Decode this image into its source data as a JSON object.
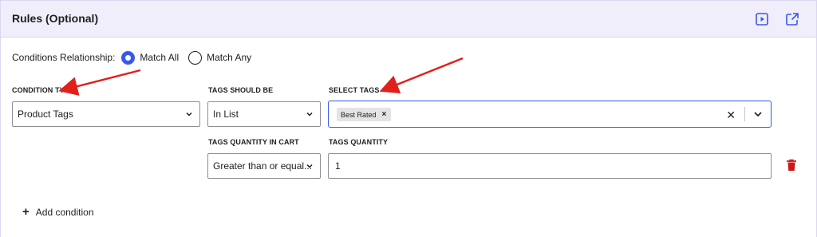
{
  "header": {
    "title": "Rules (Optional)",
    "icons": [
      "play-video-icon",
      "external-link-icon"
    ]
  },
  "relationship": {
    "label": "Conditions Relationship:",
    "options": [
      {
        "label": "Match All",
        "selected": true
      },
      {
        "label": "Match Any",
        "selected": false
      }
    ]
  },
  "condition": {
    "type_label": "CONDITION TYPE",
    "type_value": "Product Tags",
    "tags_should_be_label": "TAGS SHOULD BE",
    "tags_should_be_value": "In List",
    "select_tags_label": "SELECT TAGS",
    "selected_tags": [
      "Best Rated"
    ],
    "qty_in_cart_label": "TAGS QUANTITY IN CART",
    "qty_in_cart_value": "Greater than or equal...",
    "tags_quantity_label": "TAGS QUANTITY",
    "tags_quantity_value": "1"
  },
  "actions": {
    "add_condition": "Add condition"
  },
  "colors": {
    "accent": "#3858e9",
    "header_bg": "#f0eefb",
    "delete": "#cc1818",
    "annotation_arrow": "#e0201a"
  }
}
